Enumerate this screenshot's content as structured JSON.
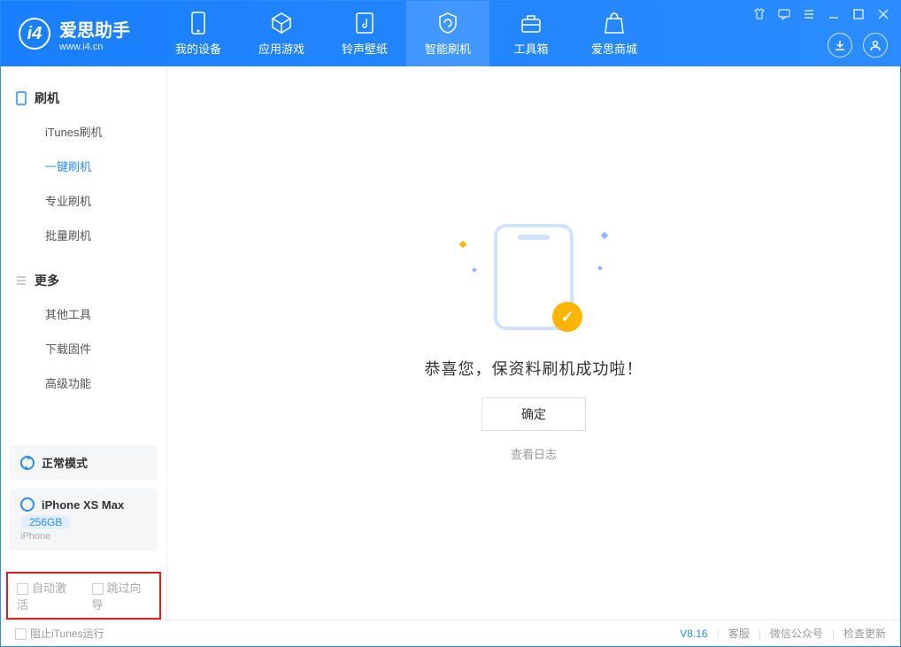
{
  "app": {
    "title": "爱思助手",
    "subtitle": "www.i4.cn"
  },
  "nav": {
    "tabs": [
      {
        "label": "我的设备"
      },
      {
        "label": "应用游戏"
      },
      {
        "label": "铃声壁纸"
      },
      {
        "label": "智能刷机"
      },
      {
        "label": "工具箱"
      },
      {
        "label": "爱思商城"
      }
    ]
  },
  "sidebar": {
    "group1": {
      "title": "刷机",
      "items": [
        "iTunes刷机",
        "一键刷机",
        "专业刷机",
        "批量刷机"
      ]
    },
    "group2": {
      "title": "更多",
      "items": [
        "其他工具",
        "下载固件",
        "高级功能"
      ]
    }
  },
  "device": {
    "mode": "正常模式",
    "name": "iPhone XS Max",
    "storage": "256GB",
    "type": "iPhone"
  },
  "options": {
    "auto_activate": "自动激活",
    "skip_wizard": "跳过向导"
  },
  "main": {
    "success": "恭喜您，保资料刷机成功啦！",
    "ok": "确定",
    "view_log": "查看日志"
  },
  "footer": {
    "block_itunes": "阻止iTunes运行",
    "version": "V8.16",
    "links": [
      "客服",
      "微信公众号",
      "检查更新"
    ]
  }
}
